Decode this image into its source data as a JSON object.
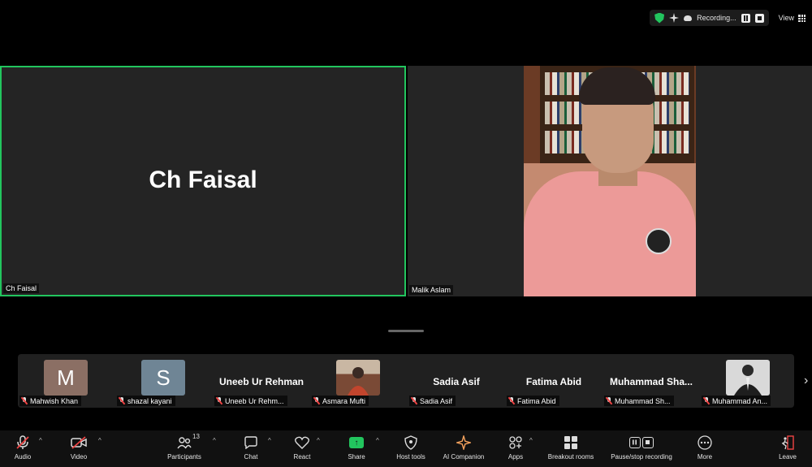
{
  "topbar": {
    "recording_label": "Recording...",
    "view_label": "View",
    "icons": [
      "shield-icon",
      "sparkle-icon",
      "cloud-icon",
      "pause-icon",
      "stop-icon",
      "grid-icon"
    ]
  },
  "tiles": [
    {
      "name": "Ch Faisal",
      "label": "Ch Faisal",
      "video": false,
      "active_speaker": true
    },
    {
      "name": "Malik Aslam",
      "label": "Malik Aslam",
      "video": true
    }
  ],
  "gallery": [
    {
      "label": "Mahwish Khan",
      "initial": "M",
      "color": "#8b6f64"
    },
    {
      "label": "shazal kayani",
      "initial": "S",
      "color": "#6f8595"
    },
    {
      "label": "Uneeb Ur Rehm...",
      "display": "Uneeb Ur Rehman"
    },
    {
      "label": "Asmara Mufti",
      "photo": true
    },
    {
      "label": "Sadia Asif",
      "display": "Sadia Asif"
    },
    {
      "label": "Fatima Abid",
      "display": "Fatima Abid"
    },
    {
      "label": "Muhammad Sh...",
      "display": "Muhammad  Sha..."
    },
    {
      "label": "Muhammad An...",
      "photo": true
    }
  ],
  "toolbar": {
    "audio": "Audio",
    "video": "Video",
    "participants": "Participants",
    "participant_count": "13",
    "chat": "Chat",
    "react": "React",
    "share": "Share",
    "host_tools": "Host tools",
    "ai_companion": "AI Companion",
    "apps": "Apps",
    "breakout_rooms": "Breakout rooms",
    "pause_stop_recording": "Pause/stop recording",
    "more": "More",
    "leave": "Leave"
  },
  "colors": {
    "active_speaker": "#22c55e",
    "muted": "#ef4444",
    "share": "#22c55e"
  }
}
